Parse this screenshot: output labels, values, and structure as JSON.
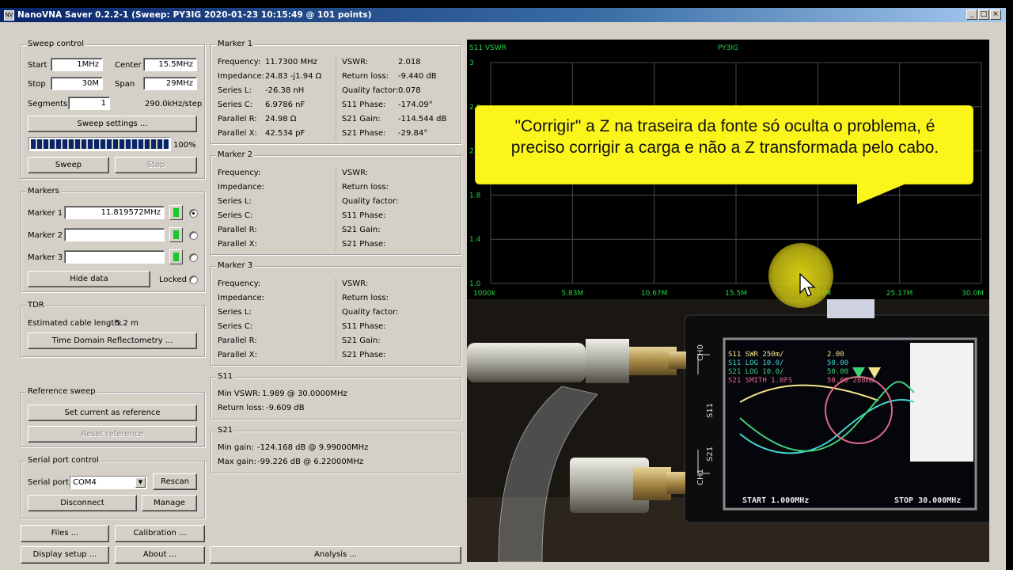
{
  "window": {
    "title": "NanoVNA Saver 0.2.2-1 (Sweep: PY3IG 2020-01-23 10:15:49 @ 101 points)",
    "app_icon": "nanovna-app-icon",
    "min": "_",
    "max": "□",
    "close": "×"
  },
  "sweep": {
    "title": "Sweep control",
    "start_label": "Start",
    "start_value": "1MHz",
    "center_label": "Center",
    "center_value": "15.5MHz",
    "stop_label": "Stop",
    "stop_value": "30M",
    "span_label": "Span",
    "span_value": "29MHz",
    "segments_label": "Segments",
    "segments_value": "1",
    "step_text": "290.0kHz/step",
    "settings_btn": "Sweep settings ...",
    "progress": 100,
    "progress_text": "100%",
    "sweep_btn": "Sweep",
    "stop_btn": "Stop"
  },
  "markers": {
    "title": "Markers",
    "items": [
      {
        "label": "Marker 1",
        "value": "11.819572MHz",
        "color": "#19c82b",
        "selected": true
      },
      {
        "label": "Marker 2",
        "value": "",
        "color": "#19c82b",
        "selected": false
      },
      {
        "label": "Marker 3",
        "value": "",
        "color": "#19c82b",
        "selected": false
      }
    ],
    "hide_btn": "Hide data",
    "locked_label": "Locked"
  },
  "tdr": {
    "title": "TDR",
    "cable_label": "Estimated cable length:",
    "cable_value": "5.2 m",
    "btn": "Time Domain Reflectometry ..."
  },
  "reference": {
    "title": "Reference sweep",
    "set_btn": "Set current as reference",
    "reset_btn": "Reset reference"
  },
  "serial": {
    "title": "Serial port control",
    "port_label": "Serial port",
    "port_value": "COM4",
    "rescan_btn": "Rescan",
    "disconnect_btn": "Disconnect",
    "manage_btn": "Manage"
  },
  "bottom": {
    "files": "Files ...",
    "calibration": "Calibration ...",
    "display": "Display setup ...",
    "about": "About ...",
    "analysis": "Analysis ..."
  },
  "marker_panels": [
    {
      "title": "Marker 1",
      "left": [
        [
          "Frequency:",
          "11.7300 MHz"
        ],
        [
          "Impedance:",
          "24.83 -j1.94 Ω"
        ],
        [
          "Series L:",
          "-26.38 nH"
        ],
        [
          "Series C:",
          "6.9786 nF"
        ],
        [
          "Parallel R:",
          "24.98 Ω"
        ],
        [
          "Parallel X:",
          "42.534 pF"
        ]
      ],
      "right": [
        [
          "VSWR:",
          "2.018"
        ],
        [
          "Return loss:",
          "-9.440 dB"
        ],
        [
          "Quality factor:",
          "0.078"
        ],
        [
          "S11 Phase:",
          "-174.09°"
        ],
        [
          "S21 Gain:",
          "-114.544 dB"
        ],
        [
          "S21 Phase:",
          "-29.84°"
        ]
      ]
    },
    {
      "title": "Marker 2",
      "left": [
        [
          "Frequency:",
          ""
        ],
        [
          "Impedance:",
          ""
        ],
        [
          "Series L:",
          ""
        ],
        [
          "Series C:",
          ""
        ],
        [
          "Parallel R:",
          ""
        ],
        [
          "Parallel X:",
          ""
        ]
      ],
      "right": [
        [
          "VSWR:",
          ""
        ],
        [
          "Return loss:",
          ""
        ],
        [
          "Quality factor:",
          ""
        ],
        [
          "S11 Phase:",
          ""
        ],
        [
          "S21 Gain:",
          ""
        ],
        [
          "S21 Phase:",
          ""
        ]
      ]
    },
    {
      "title": "Marker 3",
      "left": [
        [
          "Frequency:",
          ""
        ],
        [
          "Impedance:",
          ""
        ],
        [
          "Series L:",
          ""
        ],
        [
          "Series C:",
          ""
        ],
        [
          "Parallel R:",
          ""
        ],
        [
          "Parallel X:",
          ""
        ]
      ],
      "right": [
        [
          "VSWR:",
          ""
        ],
        [
          "Return loss:",
          ""
        ],
        [
          "Quality factor:",
          ""
        ],
        [
          "S11 Phase:",
          ""
        ],
        [
          "S21 Gain:",
          ""
        ],
        [
          "S21 Phase:",
          ""
        ]
      ]
    }
  ],
  "s11": {
    "title": "S11",
    "rows": [
      [
        "Min VSWR:",
        "1.989 @ 30.0000MHz"
      ],
      [
        "Return loss:",
        "-9.609 dB"
      ]
    ]
  },
  "s21": {
    "title": "S21",
    "rows": [
      [
        "Min gain:",
        "-124.168 dB @ 9.99000MHz"
      ],
      [
        "Max gain:",
        "-99.226 dB @ 6.22000MHz"
      ]
    ]
  },
  "chart_data": {
    "type": "line",
    "title": "PY3IG",
    "ylabel": "S11 VSWR",
    "x_ticks": [
      "1000k",
      "5.83M",
      "10.67M",
      "15.5M",
      "20.33M",
      "25.17M",
      "30.0M"
    ],
    "y_ticks": [
      "3",
      "2.6",
      "2.2",
      "1.8",
      "1.4",
      "1.0"
    ],
    "ylim": [
      1.0,
      3.0
    ],
    "grid": true,
    "line_color": "#20d640"
  },
  "overlay": {
    "caption": "\"Corrigir\" a Z na traseira da fonte só oculta o problema, é preciso corrigir a carga e não a Z transformada pelo cabo."
  },
  "photo": {
    "ch0": "CH0",
    "s11": "S11",
    "s21": "S21",
    "ch1": "CH1",
    "legend": [
      "S11 SWR 250m/",
      "S11 LOG 10.0/",
      "S21 LOG 10.0/",
      "S21 SMITH 1.0FS"
    ],
    "legend_vals": [
      "2.00",
      "50.00",
      "50.00",
      "50.00 288mΩ"
    ],
    "start": "START 1.000MHz",
    "stop": "STOP 30.000MHz"
  }
}
